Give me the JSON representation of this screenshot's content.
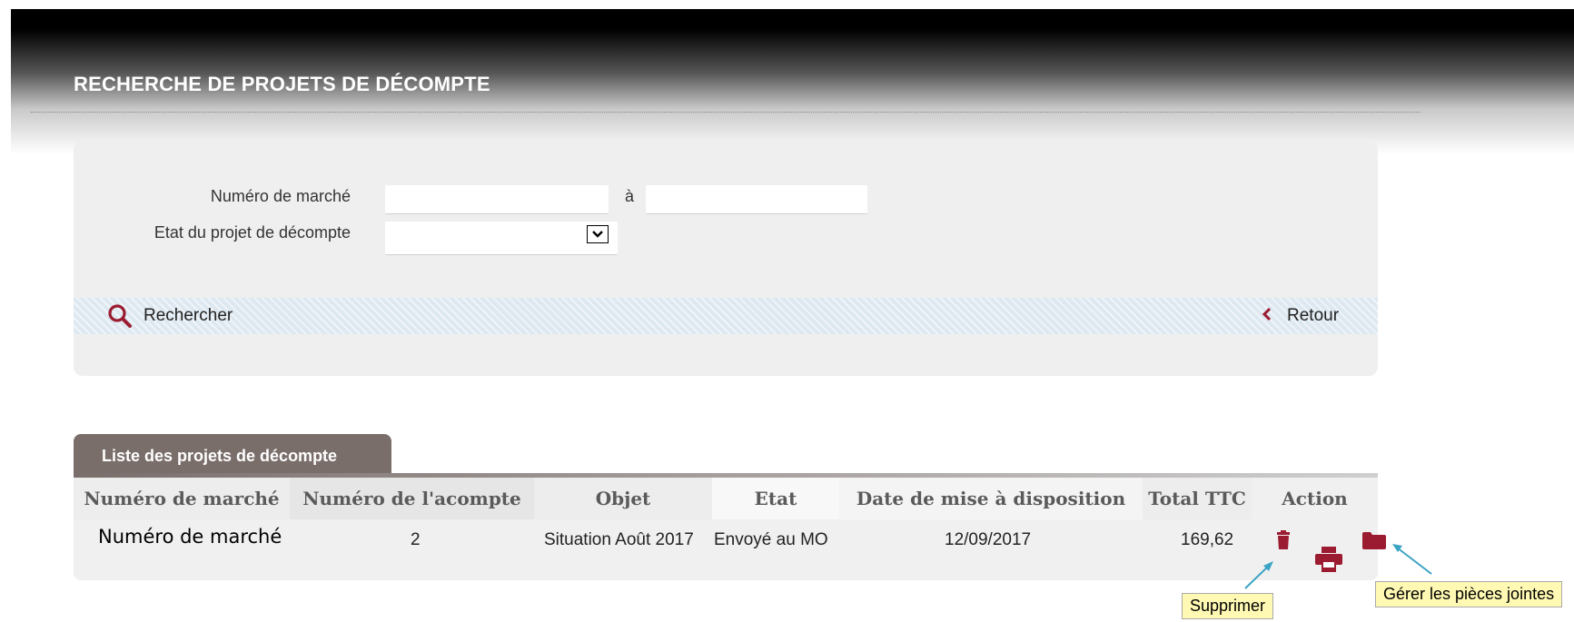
{
  "header": {
    "title": "RECHERCHE DE PROJETS DE DÉCOMPTE"
  },
  "search_form": {
    "numero_marche_label": "Numéro de marché",
    "separator_label": "à",
    "numero_marche_from": "",
    "numero_marche_to": "",
    "etat_label": "Etat du projet de décompte",
    "etat_selected": ""
  },
  "actions": {
    "search_label": "Rechercher",
    "back_label": "Retour"
  },
  "results": {
    "tab_label": "Liste des projets de décompte",
    "columns": [
      "Numéro de marché",
      "Numéro de l'acompte",
      "Objet",
      "Etat",
      "Date de mise à disposition",
      "Total TTC",
      "Action"
    ],
    "rows": [
      {
        "numero_marche": "Numéro de marché",
        "numero_acompte": "2",
        "objet": "Situation Août 2017",
        "etat": "Envoyé au MO",
        "date_mise_a_disposition": "12/09/2017",
        "total_ttc": "169,62"
      }
    ]
  },
  "row_action_icons": [
    "trash-icon",
    "print-icon",
    "folder-icon"
  ],
  "tooltips": {
    "delete": "Supprimer",
    "attachments": "Gérer les pièces jointes"
  },
  "colors": {
    "accent": "#9b1b30",
    "tab_background": "#7a6e6b",
    "annotation_arrow": "#3ba3c4",
    "tooltip_background": "#fff9b3"
  }
}
